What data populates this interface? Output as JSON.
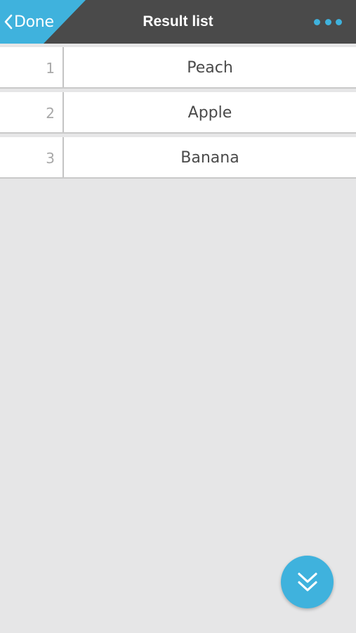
{
  "header": {
    "back_label": "Done",
    "back_icon": "chevron-left-icon",
    "title": "Result list",
    "more_icon": "more-dots-icon"
  },
  "results": [
    {
      "index": "1",
      "label": "Peach"
    },
    {
      "index": "2",
      "label": "Apple"
    },
    {
      "index": "3",
      "label": "Banana"
    }
  ],
  "fab": {
    "icon": "double-chevron-down-icon"
  },
  "colors": {
    "accent": "#3fb2dd",
    "header_bg": "#4a4a4a",
    "page_bg": "#e6e6e7",
    "row_bg": "#ffffff",
    "number_text": "#a8a8a8",
    "item_text": "#4a4a4a"
  }
}
